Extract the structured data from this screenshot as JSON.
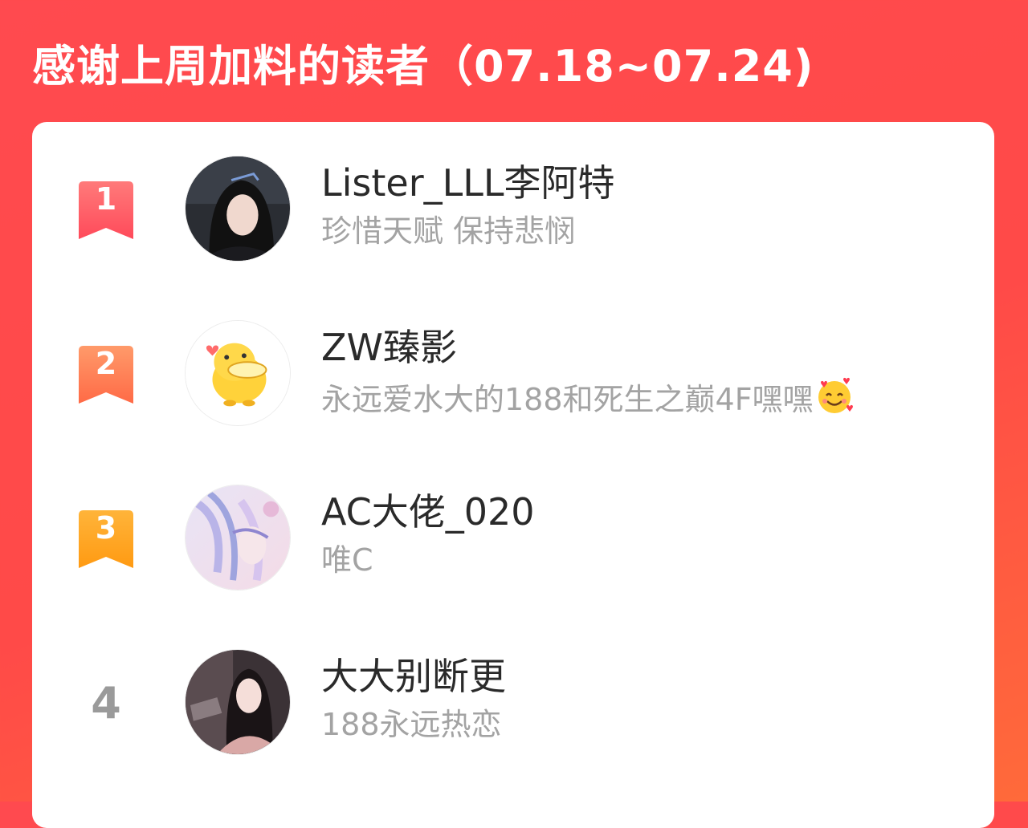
{
  "header": {
    "title": "感谢上周加料的读者（07.18~07.24)"
  },
  "colors": {
    "background": "#ff4a4f",
    "rank1": "#ff5a66",
    "rank2": "#ff7a4a",
    "rank3": "#ffa41a",
    "rank_plain": "#9a9a9a",
    "name_text": "#2a2a2a",
    "sub_text": "#a3a3a3"
  },
  "readers": [
    {
      "rank": "1",
      "name": "Lister_LLL李阿特",
      "motto": "珍惜天赋 保持悲悯",
      "avatar": "avatar-photo-girl"
    },
    {
      "rank": "2",
      "name": "ZW臻影",
      "motto": "永远爱水大的188和死生之巅4F嘿嘿",
      "emoji": "smiling-face-with-hearts-emoji",
      "avatar": "avatar-yellow-duck"
    },
    {
      "rank": "3",
      "name": "AC大佬_020",
      "motto": "唯C",
      "avatar": "avatar-anime-illustration"
    },
    {
      "rank": "4",
      "name": "大大别断更",
      "motto": "188永远热恋",
      "avatar": "avatar-photo-woman"
    }
  ]
}
